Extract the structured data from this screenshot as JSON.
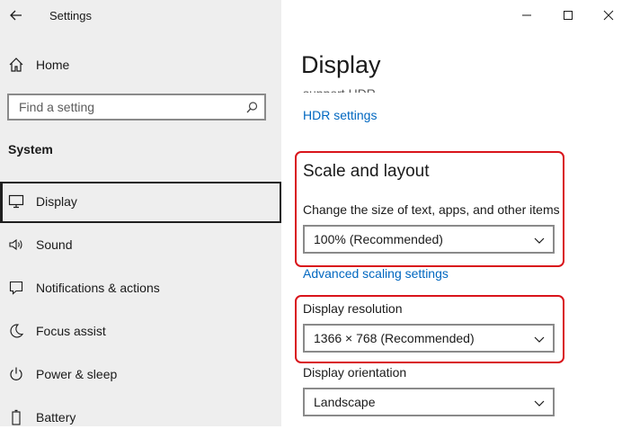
{
  "window": {
    "title": "Settings"
  },
  "sidebar": {
    "home_label": "Home",
    "search_placeholder": "Find a setting",
    "section_label": "System",
    "items": [
      {
        "label": "Display"
      },
      {
        "label": "Sound"
      },
      {
        "label": "Notifications & actions"
      },
      {
        "label": "Focus assist"
      },
      {
        "label": "Power & sleep"
      },
      {
        "label": "Battery"
      }
    ]
  },
  "main": {
    "page_title": "Display",
    "cut_text": "support HDR.",
    "hdr_link": "HDR settings",
    "scale_heading": "Scale and layout",
    "scale_label": "Change the size of text, apps, and other items",
    "scale_value": "100% (Recommended)",
    "advanced_link": "Advanced scaling settings",
    "resolution_label": "Display resolution",
    "resolution_value": "1366 × 768 (Recommended)",
    "orientation_label": "Display orientation",
    "orientation_value": "Landscape"
  },
  "colors": {
    "accent": "#0067c0",
    "highlight": "#d9141b",
    "sidebar_bg": "#eeeeee"
  }
}
